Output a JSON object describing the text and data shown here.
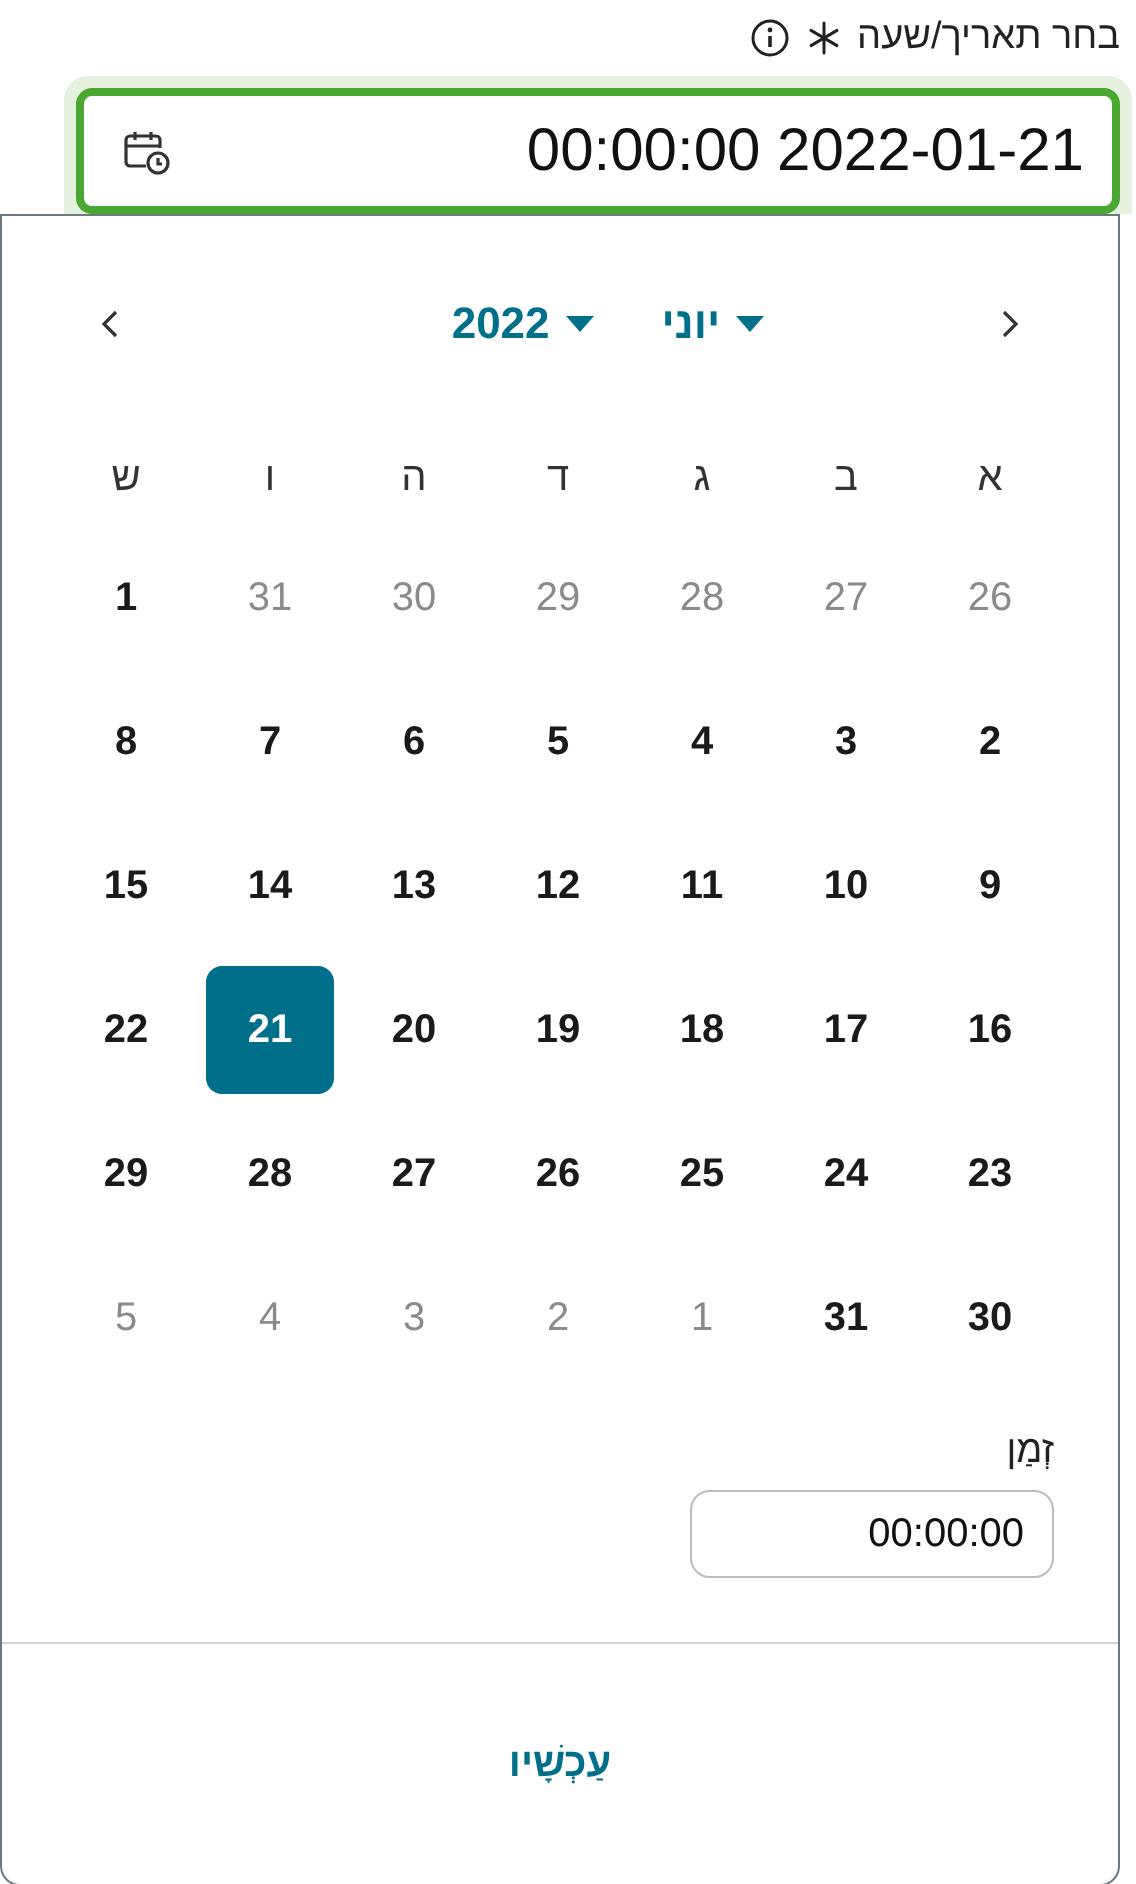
{
  "field": {
    "label": "בחר תאריך/שעה",
    "required": true,
    "value": "2022-01-21 00:00:00",
    "focused": true
  },
  "calendar": {
    "month": "יוני",
    "year": "2022",
    "weekdays": [
      "א",
      "ב",
      "ג",
      "ד",
      "ה",
      "ו",
      "ש"
    ],
    "days": [
      {
        "label": "26",
        "outside": true,
        "selected": false
      },
      {
        "label": "27",
        "outside": true,
        "selected": false
      },
      {
        "label": "28",
        "outside": true,
        "selected": false
      },
      {
        "label": "29",
        "outside": true,
        "selected": false
      },
      {
        "label": "30",
        "outside": true,
        "selected": false
      },
      {
        "label": "31",
        "outside": true,
        "selected": false
      },
      {
        "label": "1",
        "outside": false,
        "selected": false
      },
      {
        "label": "2",
        "outside": false,
        "selected": false
      },
      {
        "label": "3",
        "outside": false,
        "selected": false
      },
      {
        "label": "4",
        "outside": false,
        "selected": false
      },
      {
        "label": "5",
        "outside": false,
        "selected": false
      },
      {
        "label": "6",
        "outside": false,
        "selected": false
      },
      {
        "label": "7",
        "outside": false,
        "selected": false
      },
      {
        "label": "8",
        "outside": false,
        "selected": false
      },
      {
        "label": "9",
        "outside": false,
        "selected": false
      },
      {
        "label": "10",
        "outside": false,
        "selected": false
      },
      {
        "label": "11",
        "outside": false,
        "selected": false
      },
      {
        "label": "12",
        "outside": false,
        "selected": false
      },
      {
        "label": "13",
        "outside": false,
        "selected": false
      },
      {
        "label": "14",
        "outside": false,
        "selected": false
      },
      {
        "label": "15",
        "outside": false,
        "selected": false
      },
      {
        "label": "16",
        "outside": false,
        "selected": false
      },
      {
        "label": "17",
        "outside": false,
        "selected": false
      },
      {
        "label": "18",
        "outside": false,
        "selected": false
      },
      {
        "label": "19",
        "outside": false,
        "selected": false
      },
      {
        "label": "20",
        "outside": false,
        "selected": false
      },
      {
        "label": "21",
        "outside": false,
        "selected": true
      },
      {
        "label": "22",
        "outside": false,
        "selected": false
      },
      {
        "label": "23",
        "outside": false,
        "selected": false
      },
      {
        "label": "24",
        "outside": false,
        "selected": false
      },
      {
        "label": "25",
        "outside": false,
        "selected": false
      },
      {
        "label": "26",
        "outside": false,
        "selected": false
      },
      {
        "label": "27",
        "outside": false,
        "selected": false
      },
      {
        "label": "28",
        "outside": false,
        "selected": false
      },
      {
        "label": "29",
        "outside": false,
        "selected": false
      },
      {
        "label": "30",
        "outside": false,
        "selected": false
      },
      {
        "label": "31",
        "outside": false,
        "selected": false
      },
      {
        "label": "1",
        "outside": true,
        "selected": false
      },
      {
        "label": "2",
        "outside": true,
        "selected": false
      },
      {
        "label": "3",
        "outside": true,
        "selected": false
      },
      {
        "label": "4",
        "outside": true,
        "selected": false
      },
      {
        "label": "5",
        "outside": true,
        "selected": false
      }
    ]
  },
  "time": {
    "label": "זְמַן",
    "value": "00:00:00"
  },
  "now_button": "עַכְשָׁיו"
}
